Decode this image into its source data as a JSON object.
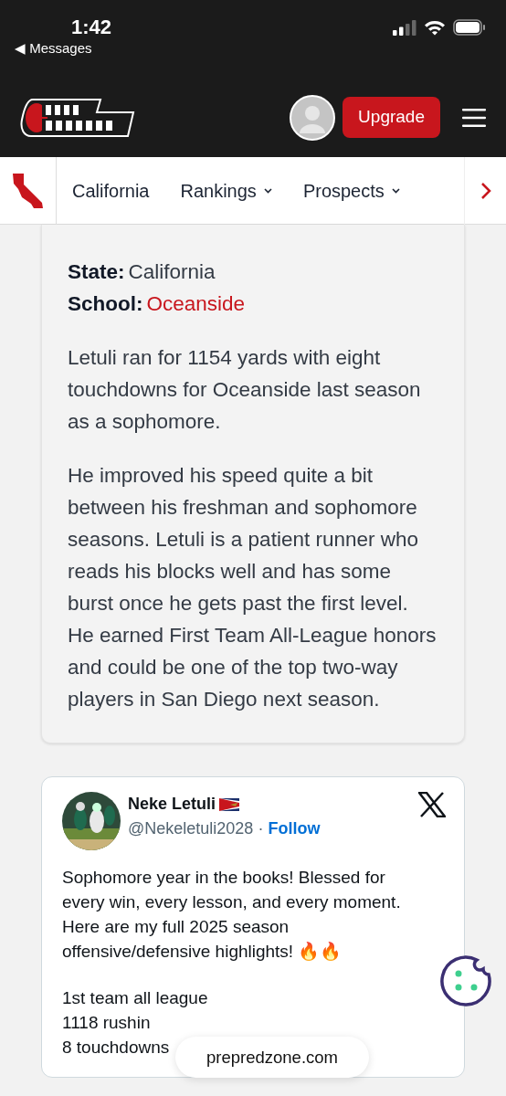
{
  "status_bar": {
    "time": "1:42",
    "back_label": "◀ Messages"
  },
  "header": {
    "upgrade_label": "Upgrade"
  },
  "nav": {
    "items": [
      {
        "label": "California",
        "dropdown": false
      },
      {
        "label": "Rankings",
        "dropdown": true
      },
      {
        "label": "Prospects",
        "dropdown": true
      }
    ]
  },
  "profile": {
    "fields": [
      {
        "label": "State:",
        "value": "California",
        "kind": "text"
      },
      {
        "label": "School:",
        "value": "Oceanside",
        "kind": "link"
      }
    ],
    "paragraphs": [
      "Letuli ran for 1154 yards with eight touchdowns for Oceanside last season as a sophomore.",
      "He improved his speed quite a bit between his freshman and sophomore seasons. Letuli is a patient runner who reads his blocks well and has some burst once he gets past the first level. He earned First Team All-League honors and could be one of the top two-way players in San Diego next season."
    ]
  },
  "tweet": {
    "name": "Neke Letuli",
    "handle": "@Nekeletuli2028",
    "separator": "·",
    "follow_label": "Follow",
    "text": "Sophomore year in the books! Blessed for every win, every lesson, and every moment. Here are my full 2025 season offensive/defensive highlights! 🔥🔥",
    "lines": [
      "1st team all league",
      "1118 rushin",
      "8 touchdowns"
    ]
  },
  "url_pill": {
    "url": "prepredzone.com"
  }
}
